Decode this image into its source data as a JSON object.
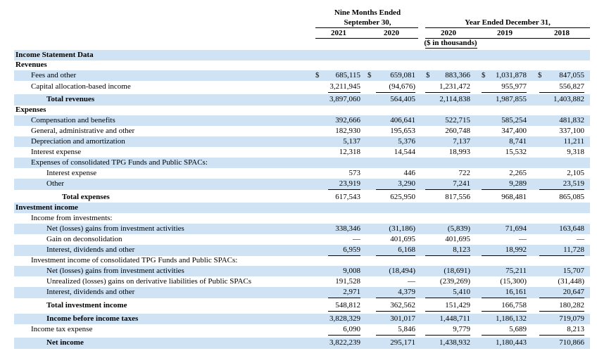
{
  "header": {
    "nine_months": "Nine Months Ended",
    "sept30": "September 30,",
    "year_ended": "Year Ended December 31,",
    "in_thousands": "($ in thousands)",
    "columns": [
      "2021",
      "2020",
      "2020",
      "2019",
      "2018"
    ]
  },
  "rows": [
    {
      "label": "Income Statement Data",
      "style": "bold",
      "indent": 0
    },
    {
      "label": "Revenues",
      "style": "bold",
      "indent": 0
    },
    {
      "label": "Fees and other",
      "indent": 1,
      "dollar": true,
      "values": [
        "685,115",
        "659,081",
        "883,366",
        "1,031,878",
        "847,055"
      ]
    },
    {
      "label": "Capital allocation-based income",
      "indent": 1,
      "values": [
        "3,211,945",
        "(94,676)",
        "1,231,472",
        "955,977",
        "556,827"
      ],
      "underline": true
    },
    {
      "label": "Total revenues",
      "style": "bold",
      "indent": 2,
      "values": [
        "3,897,060",
        "564,405",
        "2,114,838",
        "1,987,855",
        "1,403,882"
      ]
    },
    {
      "label": "Expenses",
      "style": "bold",
      "indent": 0
    },
    {
      "label": "Compensation and benefits",
      "indent": 1,
      "values": [
        "392,666",
        "406,641",
        "522,715",
        "585,254",
        "481,832"
      ]
    },
    {
      "label": "General, administrative and other",
      "indent": 1,
      "values": [
        "182,930",
        "195,653",
        "260,748",
        "347,400",
        "337,100"
      ]
    },
    {
      "label": "Depreciation and amortization",
      "indent": 1,
      "values": [
        "5,137",
        "5,376",
        "7,137",
        "8,741",
        "11,211"
      ]
    },
    {
      "label": "Interest expense",
      "indent": 1,
      "values": [
        "12,318",
        "14,544",
        "18,993",
        "15,532",
        "9,318"
      ]
    },
    {
      "label": "Expenses of consolidated TPG Funds and Public SPACs:",
      "indent": 1
    },
    {
      "label": "Interest expense",
      "indent": 2,
      "values": [
        "573",
        "446",
        "722",
        "2,265",
        "2,105"
      ]
    },
    {
      "label": "Other",
      "indent": 2,
      "values": [
        "23,919",
        "3,290",
        "7,241",
        "9,289",
        "23,519"
      ],
      "underline": true
    },
    {
      "label": "Total expenses",
      "style": "bold",
      "indent": 3,
      "values": [
        "617,543",
        "625,950",
        "817,556",
        "968,481",
        "865,085"
      ]
    },
    {
      "label": "Investment income",
      "style": "bold",
      "indent": 0
    },
    {
      "label": "Income from investments:",
      "indent": 1
    },
    {
      "label": "Net (losses) gains from investment activities",
      "indent": 2,
      "values": [
        "338,346",
        "(31,186)",
        "(5,839)",
        "71,694",
        "163,648"
      ]
    },
    {
      "label": "Gain on deconsolidation",
      "indent": 2,
      "values": [
        "—",
        "401,695",
        "401,695",
        "—",
        "—"
      ]
    },
    {
      "label": "Interest, dividends and other",
      "indent": 2,
      "values": [
        "6,959",
        "6,168",
        "8,123",
        "18,992",
        "11,728"
      ],
      "underline": true
    },
    {
      "label": "Investment income of consolidated TPG Funds and Public SPACs:",
      "indent": 1
    },
    {
      "label": "Net (losses) gains from investment activities",
      "indent": 2,
      "values": [
        "9,008",
        "(18,494)",
        "(18,691)",
        "75,211",
        "15,707"
      ]
    },
    {
      "label": "Unrealized (losses) gains on derivative liabilities of Public SPACs",
      "indent": 2,
      "values": [
        "191,528",
        "—",
        "(239,269)",
        "(15,300)",
        "(31,448)"
      ]
    },
    {
      "label": "Interest, dividends and other",
      "indent": 2,
      "values": [
        "2,971",
        "4,379",
        "5,410",
        "16,161",
        "20,647"
      ],
      "underline": true
    },
    {
      "label": "Total investment income",
      "style": "bold",
      "indent": 2,
      "values": [
        "548,812",
        "362,562",
        "151,429",
        "166,758",
        "180,282"
      ],
      "underline": true
    },
    {
      "label": "Income before income taxes",
      "style": "bold",
      "indent": 2,
      "values": [
        "3,828,329",
        "301,017",
        "1,448,711",
        "1,186,132",
        "719,079"
      ]
    },
    {
      "label": "Income tax expense",
      "indent": 1,
      "values": [
        "6,090",
        "5,846",
        "9,779",
        "5,689",
        "8,213"
      ],
      "underline": true
    },
    {
      "label": "Net income",
      "style": "bold",
      "indent": 2,
      "values": [
        "3,822,239",
        "295,171",
        "1,438,932",
        "1,180,443",
        "710,866"
      ]
    }
  ],
  "dollar_sign": "$"
}
